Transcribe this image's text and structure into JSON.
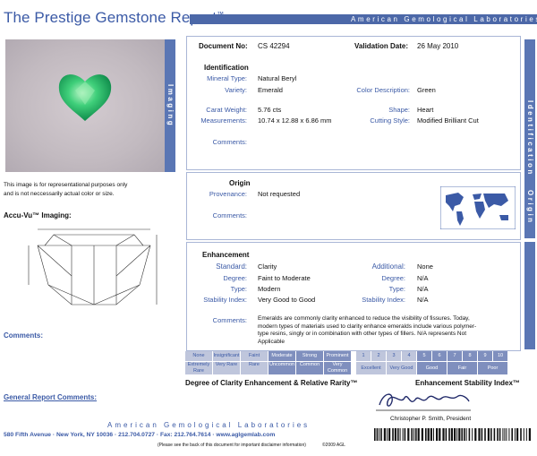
{
  "header": {
    "title": "The Prestige Gemstone Report",
    "title_mark": "™",
    "org_banner": "American Gemological Laboratories"
  },
  "tabs": {
    "imaging": "Imaging",
    "identification": "Identification",
    "origin": "Origin"
  },
  "photo_note": {
    "line1": "This image is for representational purposes only",
    "line2": "and is not neccessarily actual color or size."
  },
  "accu_vu": "Accu-Vu™ Imaging:",
  "left_comments": "Comments:",
  "general_comments": "General Report Comments:",
  "document": {
    "number_label": "Document No:",
    "number": "CS 42294",
    "validation_label": "Validation Date:",
    "validation": "26 May 2010"
  },
  "identification": {
    "heading": "Identification",
    "mineral_label": "Mineral Type:",
    "mineral": "Natural Beryl",
    "variety_label": "Variety:",
    "variety": "Emerald",
    "color_label": "Color Description:",
    "color": "Green",
    "carat_label": "Carat Weight:",
    "carat": "5.76  cts",
    "shape_label": "Shape:",
    "shape": "Heart",
    "measure_label": "Measurements:",
    "measure": "10.74 x 12.88 x 6.86 mm",
    "cutting_label": "Cutting Style:",
    "cutting": "Modified Brilliant Cut",
    "comments_label": "Comments:"
  },
  "origin": {
    "heading": "Origin",
    "provenance_label": "Provenance:",
    "provenance": "Not requested",
    "comments_label": "Comments:"
  },
  "enhancement": {
    "heading": "Enhancement",
    "standard_label": "Standard:",
    "standard": "Clarity",
    "degree_label": "Degree:",
    "degree": "Faint to Moderate",
    "type_label": "Type:",
    "type": "Modern",
    "stability_label": "Stability Index:",
    "stability": "Very Good to Good",
    "additional_label": "Additional:",
    "additional": "None",
    "add_degree_label": "Degree:",
    "add_degree": "N/A",
    "add_type_label": "Type:",
    "add_type": "N/A",
    "add_stability_label": "Stability Index:",
    "add_stability": "N/A",
    "comments_label": "Comments:",
    "comments_line1": "Emeralds are commonly clarity enhanced to reduce the visibility of fissures. Today,",
    "comments_line2": "modern types of materials used to clarity enhance emeralds include various polymer-",
    "comments_line3": "type resins, singly or in combination with other types of fillers. N/A represents Not",
    "comments_line4": "Applicable"
  },
  "clarity_scale": {
    "caption": "Degree of Clarity Enhancement & Relative Rarity™",
    "top": [
      "None",
      "Insignificant",
      "Faint",
      "Moderate",
      "Strong",
      "Prominent"
    ],
    "bottom": [
      "Extremely Rare",
      "Very Rare",
      "Rare",
      "Uncommon",
      "Common",
      "Very Common"
    ]
  },
  "stability_scale": {
    "caption": "Enhancement Stability Index™",
    "numbers": [
      "1",
      "2",
      "3",
      "4",
      "5",
      "6",
      "7",
      "8",
      "9",
      "10"
    ],
    "labels": [
      "Excellent",
      "Very Good",
      "Good",
      "Fair",
      "Poor"
    ]
  },
  "signature": {
    "name": "Christopher P. Smith, President"
  },
  "footer": {
    "banner": "American Gemological Laboratories",
    "address": "580 Fifth Avenue  ·  New York, NY 10036  ·  212.704.0727  ·  Fax: 212.764.7614  ·  www.aglgemlab.com",
    "disclaimer": "(Please see the back of this document for important disclaimer information)",
    "copyright": "©2009 AGL"
  }
}
